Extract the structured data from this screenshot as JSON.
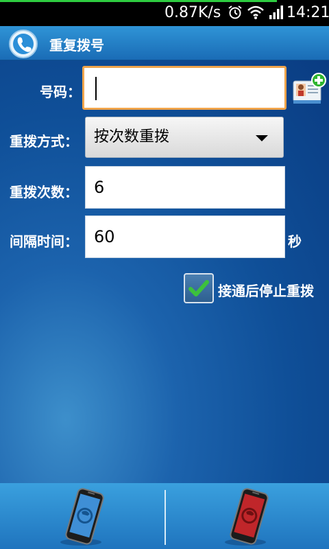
{
  "status_bar": {
    "speed": "0.87K/s",
    "time": "14:21",
    "icons": [
      "alarm-icon",
      "wifi-icon",
      "signal-icon"
    ]
  },
  "titlebar": {
    "title": "重复拨号",
    "icon": "phone-handset-icon"
  },
  "form": {
    "number_label": "号码：",
    "number_value": "",
    "mode_label": "重拨方式：",
    "mode_value": "按次数重拨",
    "count_label": "重拨次数：",
    "count_value": "6",
    "interval_label": "间隔时间：",
    "interval_value": "60",
    "interval_unit": "秒",
    "stop_checkbox_label": "接通后停止重拨",
    "stop_checkbox_checked": true
  },
  "bottom_bar": {
    "left_button": "start-dial-phone-icon",
    "right_button": "stop-dial-phone-icon"
  },
  "colors": {
    "accent": "#1a6cb6",
    "focus_border": "#f0a44b",
    "check": "#3cc13c",
    "stop_red": "#c0262a"
  }
}
